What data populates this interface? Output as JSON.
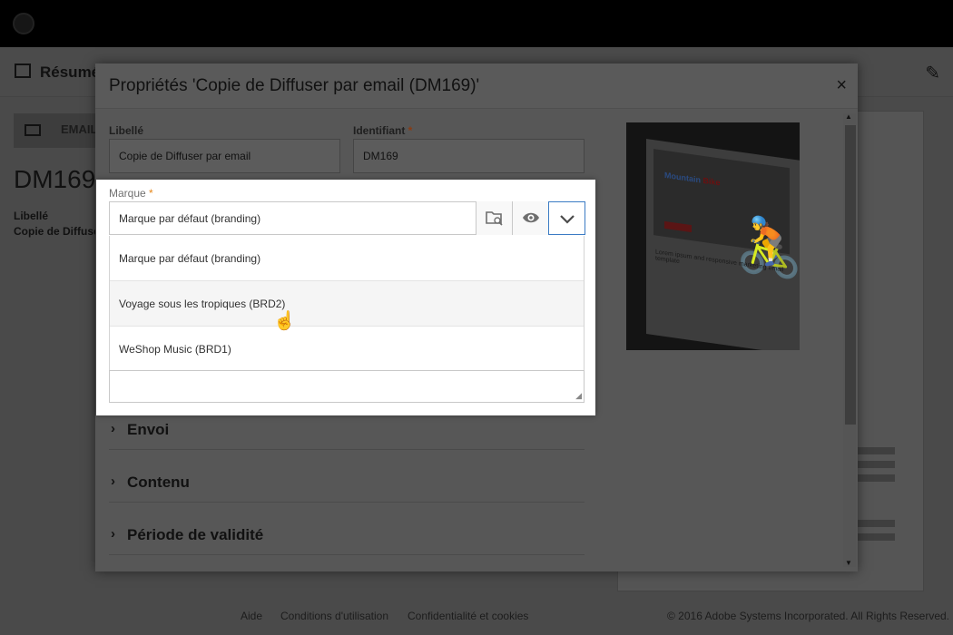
{
  "app": {
    "summary_label": "Résumé",
    "email_tab_label": "EMAIL",
    "delivery_code": "DM169",
    "libelle_label": "Libellé",
    "libelle_value": "Copie de Diffuser"
  },
  "footer": {
    "links": [
      "Aide",
      "Conditions d'utilisation",
      "Confidentialité et cookies"
    ],
    "copyright": "© 2016 Adobe Systems Incorporated. All Rights Reserved."
  },
  "modal": {
    "title": "Propriétés 'Copie de Diffuser par email (DM169)'",
    "close_glyph": "×",
    "fields": {
      "libelle_label": "Libellé",
      "libelle_value": "Copie de Diffuser par email",
      "identifiant_label": "Identifiant",
      "identifiant_value": "DM169",
      "required_mark": "*"
    },
    "marque": {
      "label": "Marque",
      "required_mark": "*",
      "selected": "Marque par défaut (branding)",
      "options": [
        "Marque par défaut (branding)",
        "Voyage sous les tropiques (BRD2)",
        "WeShop Music (BRD1)"
      ],
      "hovered_index": 1
    },
    "sections": [
      "Envoi",
      "Contenu",
      "Période de validité"
    ],
    "preview": {
      "brand_text": "geometrix",
      "headline_a": "Mountain",
      "headline_b": "Bike",
      "body_text": "Lorem ipsum and responsive marketing email template"
    }
  },
  "colors": {
    "accent": "#3b7bc4",
    "required": "#e68619",
    "overlay": "#000000"
  }
}
